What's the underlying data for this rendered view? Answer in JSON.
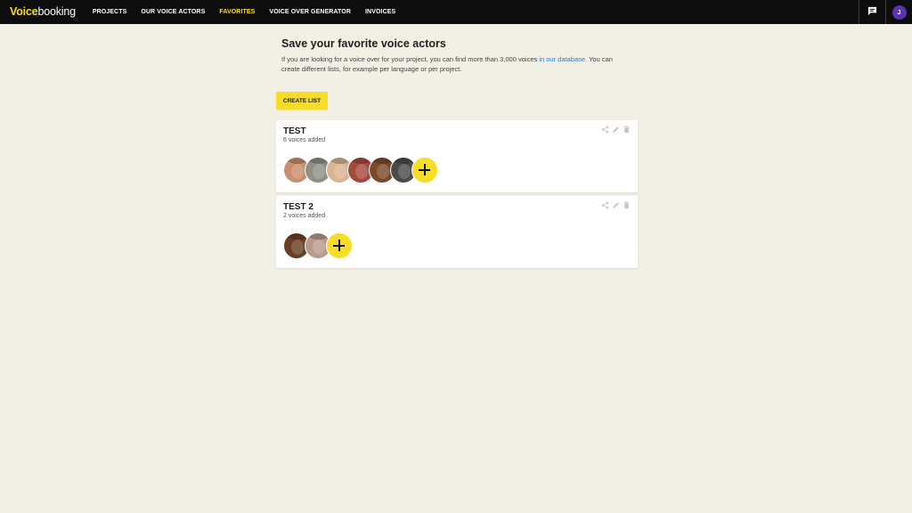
{
  "header": {
    "logo_part1": "Voice",
    "logo_part2": "booking",
    "nav": [
      {
        "label": "PROJECTS"
      },
      {
        "label": "OUR VOICE ACTORS"
      },
      {
        "label": "FAVORITES",
        "active": true
      },
      {
        "label": "VOICE OVER GENERATOR"
      },
      {
        "label": "INVOICES"
      }
    ],
    "chat_icon": "chat-icon",
    "user_initial": "J"
  },
  "main": {
    "title": "Save your favorite voice actors",
    "intro_before": "If you are looking for a voice over for your project, you can find more than 3,000 voices ",
    "intro_link": "in our database",
    "intro_after": ". You can create different lists, for example per language or per project.",
    "create_list_label": "CREATE LIST"
  },
  "lists": [
    {
      "name": "TEST",
      "count_label": "6 voices added",
      "actor_avatar_colors": [
        "#c98f6f",
        "#8f8f86",
        "#d8b592",
        "#a44a3d",
        "#7a4a2c",
        "#4d4a4c"
      ]
    },
    {
      "name": "TEST 2",
      "count_label": "2 voices added",
      "actor_avatar_colors": [
        "#6a3e24",
        "#b99a8a"
      ]
    }
  ],
  "colors": {
    "accent": "#f7dd27",
    "topbar": "#0d0d0d",
    "background": "#f2efe4",
    "link": "#2a7bd3",
    "user_avatar": "#5a33b5"
  }
}
